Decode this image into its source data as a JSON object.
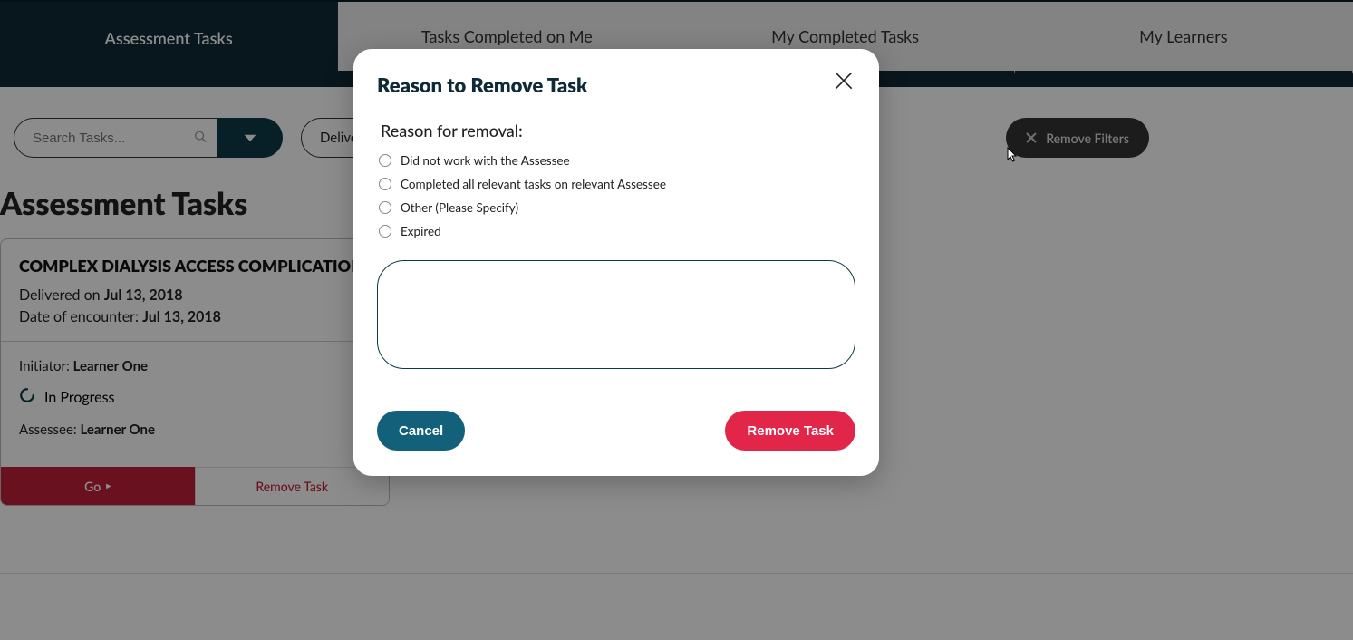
{
  "tabs": {
    "items": [
      {
        "label": "Assessment Tasks",
        "active": true
      },
      {
        "label": "Tasks Completed on Me",
        "active": false
      },
      {
        "label": "My Completed Tasks",
        "active": false
      },
      {
        "label": "My Learners",
        "active": false
      }
    ]
  },
  "filters": {
    "search_placeholder": "Search Tasks...",
    "delivery_label_prefix": "Delive",
    "remove_filters_label": "Remove Filters"
  },
  "page": {
    "title": "Assessment Tasks"
  },
  "task_card": {
    "title": "COMPLEX DIALYSIS ACCESS COMPLICATION",
    "delivered_label": "Delivered on ",
    "delivered_date": "Jul 13, 2018",
    "encounter_label": "Date of encounter: ",
    "encounter_date": "Jul 13, 2018",
    "initiator_label": "Initiator: ",
    "initiator_name": "Learner One",
    "status_text": "In Progress",
    "assessee_label": "Assessee: ",
    "assessee_name": "Learner One",
    "go_label": "Go",
    "remove_label": "Remove Task"
  },
  "modal": {
    "title": "Reason to Remove Task",
    "subtitle": "Reason for removal:",
    "options": [
      "Did not work with the Assessee",
      "Completed all relevant tasks on relevant Assessee",
      "Other (Please Specify)",
      "Expired"
    ],
    "textarea_value": "",
    "cancel_label": "Cancel",
    "remove_label": "Remove Task"
  }
}
